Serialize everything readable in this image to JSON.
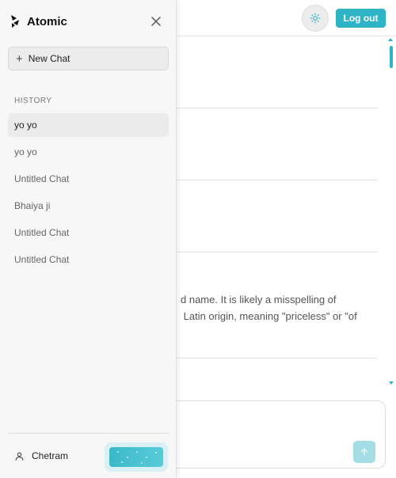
{
  "app": {
    "name": "Atomic"
  },
  "header": {
    "logout_label": "Log out",
    "theme_icon": "sun-icon"
  },
  "sidebar": {
    "new_chat_label": "New Chat",
    "history_heading": "HISTORY",
    "history_items": [
      {
        "label": "yo yo",
        "active": true
      },
      {
        "label": "yo yo",
        "active": false
      },
      {
        "label": "Untitled Chat",
        "active": false
      },
      {
        "label": "Bhaiya ji",
        "active": false
      },
      {
        "label": "Untitled Chat",
        "active": false
      },
      {
        "label": "Untitled Chat",
        "active": false
      }
    ],
    "user_name": "Chetram"
  },
  "main": {
    "message_excerpt_line1": "d name. It is likely a misspelling of",
    "message_excerpt_line2": " Latin origin, meaning \"priceless\" or \"of"
  },
  "colors": {
    "accent": "#2fb3c6",
    "sidebar_bg": "#f7f7f7",
    "send_button": "#a4dde6"
  }
}
